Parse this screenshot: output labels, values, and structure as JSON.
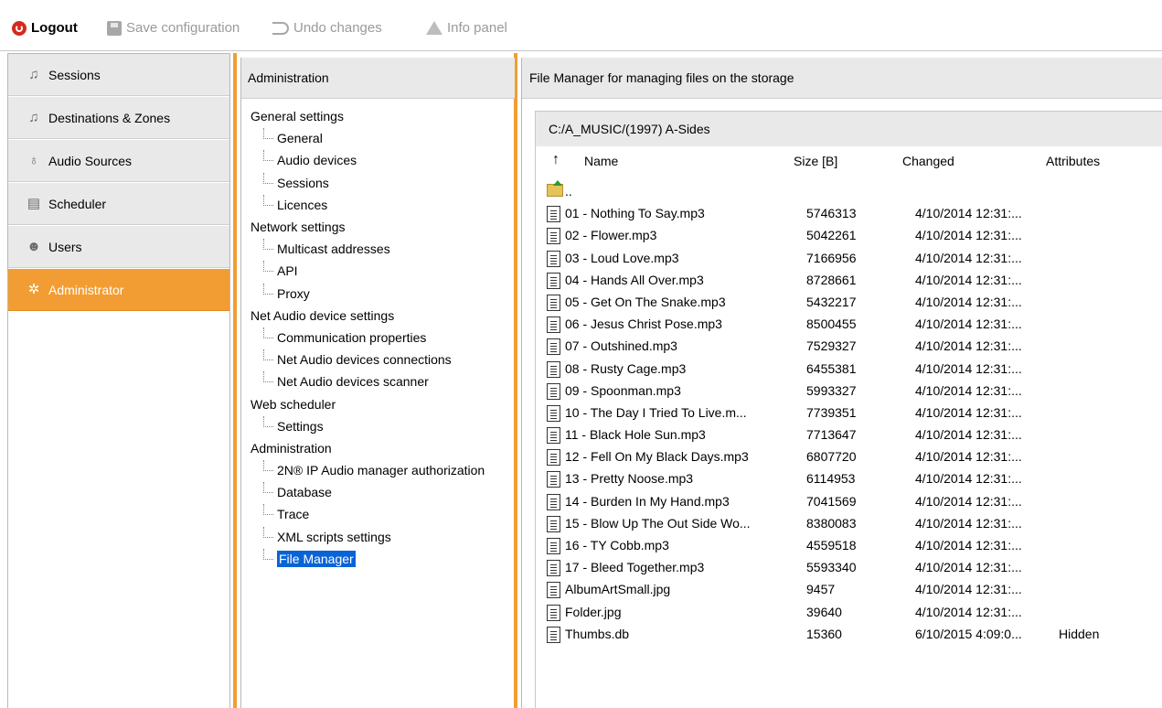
{
  "toolbar": {
    "logout": "Logout",
    "save": "Save configuration",
    "undo": "Undo changes",
    "info": "Info panel"
  },
  "nav": {
    "items": [
      {
        "label": "Sessions",
        "icon": "music-note-icon"
      },
      {
        "label": "Destinations & Zones",
        "icon": "music-note-icon"
      },
      {
        "label": "Audio Sources",
        "icon": "microphone-icon"
      },
      {
        "label": "Scheduler",
        "icon": "calendar-icon"
      },
      {
        "label": "Users",
        "icon": "users-icon"
      },
      {
        "label": "Administrator",
        "icon": "gear-icon"
      }
    ],
    "active_color": "#f29d33"
  },
  "admin": {
    "header": "Administration",
    "tree": [
      {
        "label": "General settings"
      },
      {
        "label": "General"
      },
      {
        "label": "Audio devices"
      },
      {
        "label": "Sessions"
      },
      {
        "label": "Licences"
      },
      {
        "label": "Network settings"
      },
      {
        "label": "Multicast addresses"
      },
      {
        "label": "API"
      },
      {
        "label": "Proxy"
      },
      {
        "label": "Net Audio device settings"
      },
      {
        "label": "Communication properties"
      },
      {
        "label": "Net Audio devices connections"
      },
      {
        "label": "Net Audio devices scanner"
      },
      {
        "label": "Web scheduler"
      },
      {
        "label": "Settings"
      },
      {
        "label": "Administration"
      },
      {
        "label": "2N® IP Audio manager authorization"
      },
      {
        "label": "Database"
      },
      {
        "label": "Trace"
      },
      {
        "label": "XML scripts settings"
      },
      {
        "label": "File Manager"
      }
    ]
  },
  "file_manager": {
    "header": "File Manager for managing files on the storage",
    "path": "C:/A_MUSIC/(1997) A-Sides",
    "columns": {
      "name": "Name",
      "size": "Size [B]",
      "changed": "Changed",
      "attributes": "Attributes"
    },
    "parent": "..",
    "files": [
      {
        "name": "01 - Nothing To Say.mp3",
        "size": "5746313",
        "changed": "4/10/2014 12:31:...",
        "attr": ""
      },
      {
        "name": "02 - Flower.mp3",
        "size": "5042261",
        "changed": "4/10/2014 12:31:...",
        "attr": ""
      },
      {
        "name": "03 - Loud Love.mp3",
        "size": "7166956",
        "changed": "4/10/2014 12:31:...",
        "attr": ""
      },
      {
        "name": "04 - Hands All Over.mp3",
        "size": "8728661",
        "changed": "4/10/2014 12:31:...",
        "attr": ""
      },
      {
        "name": "05 - Get On The Snake.mp3",
        "size": "5432217",
        "changed": "4/10/2014 12:31:...",
        "attr": ""
      },
      {
        "name": "06 - Jesus Christ Pose.mp3",
        "size": "8500455",
        "changed": "4/10/2014 12:31:...",
        "attr": ""
      },
      {
        "name": "07 - Outshined.mp3",
        "size": "7529327",
        "changed": "4/10/2014 12:31:...",
        "attr": ""
      },
      {
        "name": "08 - Rusty Cage.mp3",
        "size": "6455381",
        "changed": "4/10/2014 12:31:...",
        "attr": ""
      },
      {
        "name": "09 - Spoonman.mp3",
        "size": "5993327",
        "changed": "4/10/2014 12:31:...",
        "attr": ""
      },
      {
        "name": "10 - The Day I Tried To Live.m...",
        "size": "7739351",
        "changed": "4/10/2014 12:31:...",
        "attr": ""
      },
      {
        "name": "11 - Black Hole Sun.mp3",
        "size": "7713647",
        "changed": "4/10/2014 12:31:...",
        "attr": ""
      },
      {
        "name": "12 - Fell On My Black Days.mp3",
        "size": "6807720",
        "changed": "4/10/2014 12:31:...",
        "attr": ""
      },
      {
        "name": "13 - Pretty Noose.mp3",
        "size": "6114953",
        "changed": "4/10/2014 12:31:...",
        "attr": ""
      },
      {
        "name": "14 - Burden In My Hand.mp3",
        "size": "7041569",
        "changed": "4/10/2014 12:31:...",
        "attr": ""
      },
      {
        "name": "15 - Blow Up The Out Side Wo...",
        "size": "8380083",
        "changed": "4/10/2014 12:31:...",
        "attr": ""
      },
      {
        "name": "16 - TY Cobb.mp3",
        "size": "4559518",
        "changed": "4/10/2014 12:31:...",
        "attr": ""
      },
      {
        "name": "17 - Bleed Together.mp3",
        "size": "5593340",
        "changed": "4/10/2014 12:31:...",
        "attr": ""
      },
      {
        "name": "AlbumArtSmall.jpg",
        "size": "9457",
        "changed": "4/10/2014 12:31:...",
        "attr": ""
      },
      {
        "name": "Folder.jpg",
        "size": "39640",
        "changed": "4/10/2014 12:31:...",
        "attr": ""
      },
      {
        "name": "Thumbs.db",
        "size": "15360",
        "changed": "6/10/2015 4:09:0...",
        "attr": "Hidden"
      }
    ]
  }
}
